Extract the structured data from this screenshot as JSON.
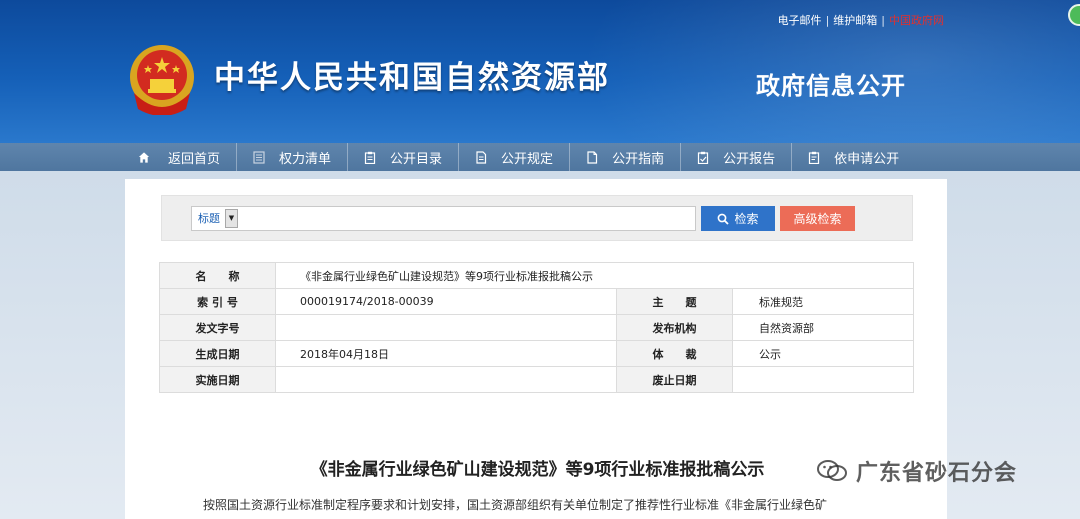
{
  "header": {
    "top_links": {
      "email": "电子邮件",
      "admin_email": "维护邮箱",
      "gov_site": "中国政府网"
    },
    "site_title": "中华人民共和国自然资源部",
    "section_title": "政府信息公开"
  },
  "nav": [
    {
      "label": "返回首页",
      "icon": "home-icon"
    },
    {
      "label": "权力清单",
      "icon": "list-icon"
    },
    {
      "label": "公开目录",
      "icon": "clipboard-icon"
    },
    {
      "label": "公开规定",
      "icon": "document-icon"
    },
    {
      "label": "公开指南",
      "icon": "page-icon"
    },
    {
      "label": "公开报告",
      "icon": "report-icon"
    },
    {
      "label": "依申请公开",
      "icon": "apply-icon"
    }
  ],
  "search": {
    "scope_label": "标题",
    "query": "",
    "search_button": "检索",
    "advanced_button": "高级检索"
  },
  "info": {
    "name_label": "名　　称",
    "name_value": "《非金属行业绿色矿山建设规范》等9项行业标准报批稿公示",
    "index_label": "索 引 号",
    "index_value": "000019174/2018-00039",
    "topic_label": "主　　题",
    "topic_value": "标准规范",
    "doc_no_label": "发文字号",
    "doc_no_value": "",
    "publisher_label": "发布机构",
    "publisher_value": "自然资源部",
    "created_label": "生成日期",
    "created_value": "2018年04月18日",
    "genre_label": "体　　裁",
    "genre_value": "公示",
    "effective_label": "实施日期",
    "effective_value": "",
    "expiry_label": "废止日期",
    "expiry_value": ""
  },
  "article": {
    "title": "《非金属行业绿色矿山建设规范》等9项行业标准报批稿公示",
    "body": "按照国土资源行业标准制定程序要求和计划安排，国土资源部组织有关单位制定了推荐性行业标准《非金属行业绿色矿"
  },
  "watermark": {
    "text": "广东省砂石分会"
  },
  "colors": {
    "header_blue": "#1560b8",
    "nav_bar": "#5679a3",
    "search_button": "#2f73c9",
    "advanced_button": "#ec6c57",
    "gov_site_link": "#e03030"
  }
}
